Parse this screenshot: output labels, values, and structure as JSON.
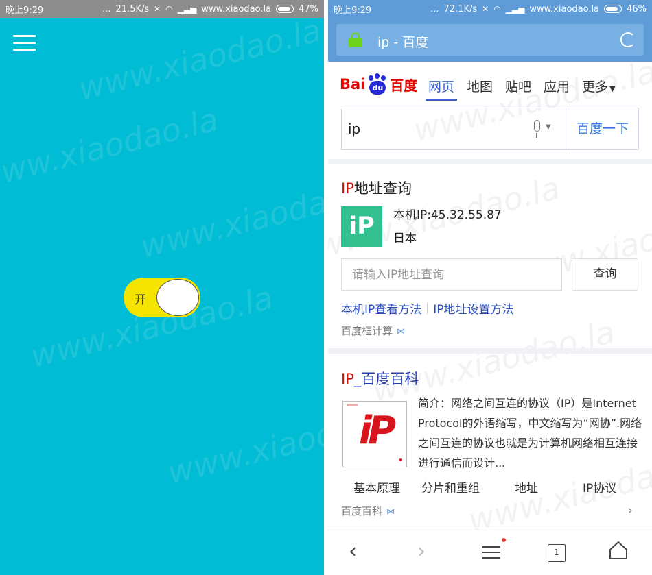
{
  "left_screen": {
    "status_bar": {
      "time": "晚上9:29",
      "dots": "...",
      "speed": "21.5K/s",
      "site": "www.xiaodao.la",
      "battery": "47%",
      "battery_level": 0.47
    },
    "watermark": "www.xiaodao.la",
    "toggle": {
      "label": "开",
      "state": "on"
    }
  },
  "right_screen": {
    "status_bar": {
      "time": "晚上9:29",
      "dots": "...",
      "speed": "72.1K/s",
      "site": "www.xiaodao.la",
      "battery": "46%",
      "battery_level": 0.46
    },
    "watermark": "www.xiaodao.la",
    "address_bar": {
      "title": "ip - 百度"
    },
    "baidu": {
      "logo_bai": "Bai",
      "logo_du_paw": "du",
      "logo_du": "百度",
      "tabs": [
        {
          "label": "网页",
          "active": true
        },
        {
          "label": "地图",
          "active": false
        },
        {
          "label": "贴吧",
          "active": false
        },
        {
          "label": "应用",
          "active": false
        },
        {
          "label": "更多",
          "active": false
        }
      ],
      "search": {
        "value": "ip",
        "button": "百度一下"
      }
    },
    "card_ip": {
      "title_ip": "IP",
      "title_rest": "地址查询",
      "logo_text": "iP",
      "line1": "本机IP:45.32.55.87",
      "line2": "日本",
      "query_placeholder": "请输入IP地址查询",
      "query_button": "查询",
      "link1": "本机IP查看方法",
      "link2": "IP地址设置方法",
      "source": "百度框计算"
    },
    "card_baike": {
      "title_ip": "IP",
      "title_rest": "_百度百科",
      "description": "简介：网络之间互连的协议（IP）是Internet Protocol的外语缩写，中文缩写为“网协”.网络之间互连的协议也就是为计算机网络相互连接进行通信而设计...",
      "tags": [
        "基本原理",
        "分片和重组",
        "地址",
        "IP协议"
      ],
      "source": "百度百科",
      "more": "›"
    },
    "bottom_nav": {
      "tab_count": "1"
    }
  },
  "colors": {
    "left_bg": "#00bcd4",
    "toggle_on": "#f5e400",
    "browser_bar": "#5f9bd6",
    "baidu_red": "#e10601",
    "baidu_blue": "#2529d8",
    "link_blue": "#2a4fbc",
    "ip_logo_green": "#34bf8e"
  }
}
